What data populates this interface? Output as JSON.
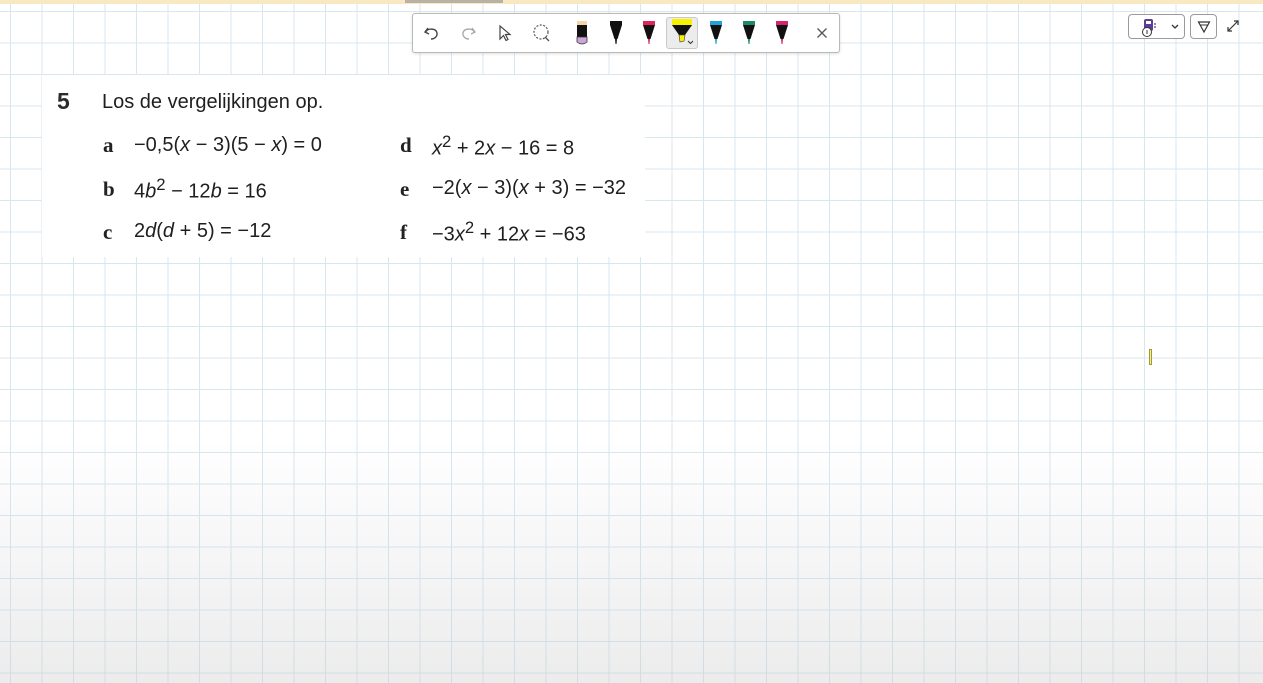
{
  "colors": {
    "grid_line": "#d7e7f0",
    "top_strip": "#f8e9c2",
    "highlighter_yellow": "#f7f300",
    "pen_black": "#111111",
    "pen_red": "#e0245e",
    "pen_cyan": "#1aa6d8",
    "pen_green": "#1a8a6a",
    "pen_magenta": "#d6246f",
    "eraser_lilac": "#c9a6d8"
  },
  "toolbar": {
    "icons": {
      "undo": "undo-icon",
      "redo": "redo-icon",
      "select": "select-cursor-icon",
      "lasso": "lasso-icon",
      "eraser": "eraser-icon",
      "close": "close-icon"
    }
  },
  "exercise": {
    "number": "5",
    "title": "Los de vergelijkingen op.",
    "items": [
      {
        "letter": "a",
        "eq": "−0,5(<i>x</i> − 3)(5 − <i>x</i>) = 0"
      },
      {
        "letter": "b",
        "eq": "4<i>b</i><sup>2</sup> − 12<i>b</i> = 16"
      },
      {
        "letter": "c",
        "eq": "2<i>d</i>(<i>d</i> + 5) = −12"
      },
      {
        "letter": "d",
        "eq": "<i>x</i><sup>2</sup> + 2<i>x</i> − 16 = 8"
      },
      {
        "letter": "e",
        "eq": "−2(<i>x</i> − 3)(<i>x</i> + 3) = −32"
      },
      {
        "letter": "f",
        "eq": "−3<i>x</i><sup>2</sup> + 12<i>x</i> = −63"
      }
    ]
  }
}
